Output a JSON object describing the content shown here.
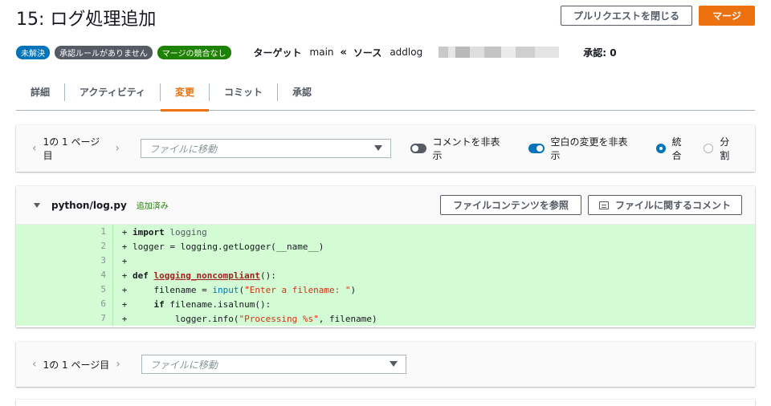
{
  "header": {
    "title": "15: ログ処理追加",
    "close_pr_label": "プルリクエストを閉じる",
    "merge_label": "マージ"
  },
  "meta": {
    "badges": [
      "未解決",
      "承認ルールがありません",
      "マージの競合なし"
    ],
    "target_label": "ターゲット",
    "target_value": "main",
    "source_label": "ソース",
    "source_value": "addlog",
    "approvals": "承認: 0"
  },
  "tabs": [
    "詳細",
    "アクティビティ",
    "変更",
    "コミット",
    "承認"
  ],
  "active_tab": "変更",
  "toolbar": {
    "page_text": "1の 1 ページ目",
    "file_select_placeholder": "ファイルに移動",
    "hide_comments_label": "コメントを非表示",
    "hide_whitespace_label": "空白の変更を非表示",
    "unified_label": "統合",
    "split_label": "分割"
  },
  "file": {
    "name": "python/log.py",
    "status": "追加済み",
    "view_contents_label": "ファイルコンテンツを参照",
    "comment_file_label": "ファイルに関するコメント"
  },
  "code_lines": [
    {
      "num": "1",
      "sign": "+",
      "text": "import logging"
    },
    {
      "num": "2",
      "sign": "+",
      "text": "logger = logging.getLogger(__name__)"
    },
    {
      "num": "3",
      "sign": "+",
      "text": ""
    },
    {
      "num": "4",
      "sign": "+",
      "text": "def logging_noncompliant():"
    },
    {
      "num": "5",
      "sign": "+",
      "text": "    filename = input(\"Enter a filename: \")"
    },
    {
      "num": "6",
      "sign": "+",
      "text": "    if filename.isalnum():"
    },
    {
      "num": "7",
      "sign": "+",
      "text": "        logger.info(\"Processing %s\", filename)"
    }
  ],
  "bottom_toolbar": {
    "page_text": "1の 1 ページ目",
    "file_select_placeholder": "ファイルに移動"
  },
  "colors": {
    "accent": "#ec7211",
    "link_blue": "#0073bb",
    "added_bg": "#d4fcd4",
    "success": "#1d8102"
  }
}
